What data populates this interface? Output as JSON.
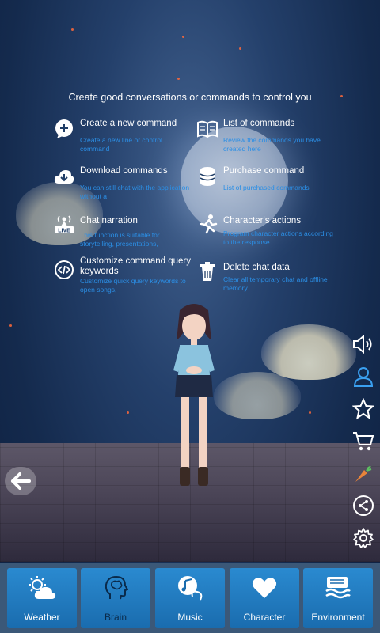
{
  "header": {
    "title": "Create good conversations or commands to control you"
  },
  "commands": [
    {
      "title": "Create a new command",
      "desc": "Create a new line or control command",
      "icon": "add-comment-icon"
    },
    {
      "title": "List of commands",
      "desc": "Review the commands you have created here",
      "icon": "book-icon"
    },
    {
      "title": "Download commands",
      "desc": "You can still chat with the application without a",
      "icon": "cloud-download-icon"
    },
    {
      "title": "Purchase command",
      "desc": "List of purchased commands",
      "icon": "coins-icon"
    },
    {
      "title": "Chat narration",
      "desc": "This function is suitable for storytelling, presentations,",
      "icon": "live-broadcast-icon"
    },
    {
      "title": "Character's actions",
      "desc": "Program character actions according to the response",
      "icon": "running-person-icon"
    },
    {
      "title": "Customize command query keywords",
      "desc": "Customize quick query keywords to open songs,",
      "icon": "code-icon"
    },
    {
      "title": "Delete chat data",
      "desc": "Clear all temporary chat and offline memory",
      "icon": "trash-icon"
    }
  ],
  "side_toolbar": [
    "speaker-icon",
    "user-icon",
    "star-icon",
    "cart-icon",
    "carrot-icon",
    "share-icon",
    "settings-icon"
  ],
  "dock": {
    "weather": "Weather",
    "brain": "Brain",
    "music": "Music",
    "character": "Character",
    "environment": "Environment"
  },
  "colors": {
    "desc_text": "#2b8fe6",
    "tile": "#2a8ad0",
    "dock_bg": "#3b5878"
  }
}
